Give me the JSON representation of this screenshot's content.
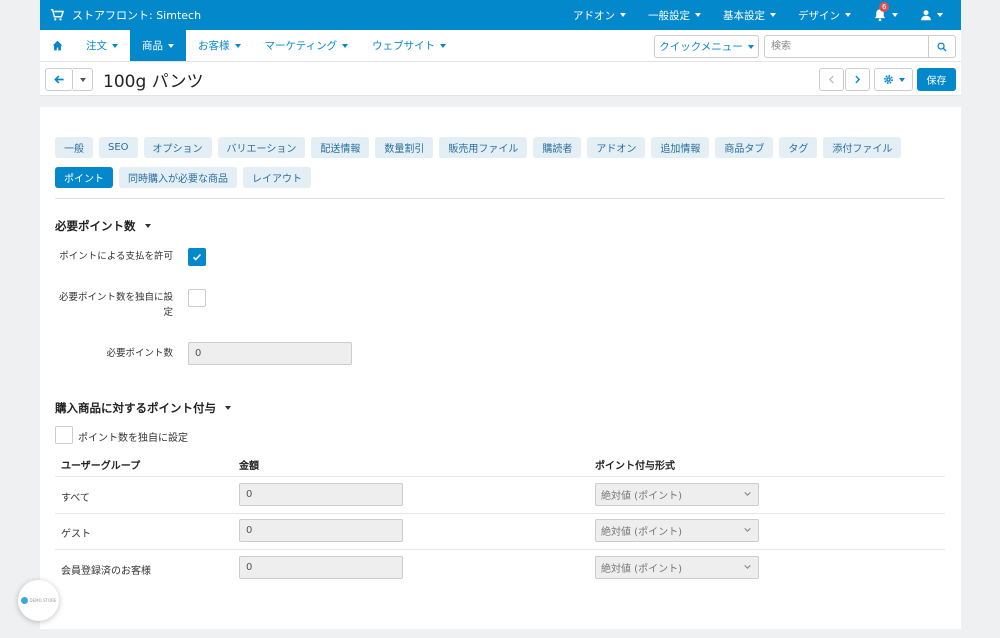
{
  "topbar": {
    "store_name": "ストアフロント: Simtech",
    "menu": [
      "アドオン",
      "一般設定",
      "基本設定",
      "デザイン"
    ],
    "notification_count": "6"
  },
  "nav": {
    "items": [
      "注文",
      "商品",
      "お客様",
      "マーケティング",
      "ウェブサイト"
    ],
    "active_index": 1,
    "quick_menu": "クイックメニュー",
    "search_placeholder": "検索"
  },
  "titlebar": {
    "title": "100g パンツ",
    "save_label": "保存"
  },
  "tabs": {
    "row1": [
      "一般",
      "SEO",
      "オプション",
      "バリエーション",
      "配送情報",
      "数量割引",
      "販売用ファイル",
      "購読者",
      "アドオン",
      "追加情報",
      "商品タブ",
      "タグ",
      "添付ファイル"
    ],
    "row2": [
      "ポイント",
      "同時購入が必要な商品",
      "レイアウト"
    ],
    "active": "ポイント"
  },
  "required_points": {
    "title": "必要ポイント数",
    "allow_pay_label": "ポイントによる支払を許可",
    "allow_pay_checked": true,
    "override_label_1": "必要ポイント数を独自に設",
    "override_label_2": "定",
    "override_checked": false,
    "points_label": "必要ポイント数",
    "points_value": "0"
  },
  "reward_points": {
    "title": "購入商品に対するポイント付与",
    "override_label": "ポイント数を独自に設定",
    "override_checked": false,
    "headers": [
      "ユーザーグループ",
      "金額",
      "ポイント付与形式"
    ],
    "rows": [
      {
        "group": "すべて",
        "amount": "0",
        "type": "絶対値 (ポイント)"
      },
      {
        "group": "ゲスト",
        "amount": "0",
        "type": "絶対値 (ポイント)"
      },
      {
        "group": "会員登録済のお客様",
        "amount": "0",
        "type": "絶対値 (ポイント)"
      }
    ]
  },
  "demo_badge": "DEMO STORE"
}
